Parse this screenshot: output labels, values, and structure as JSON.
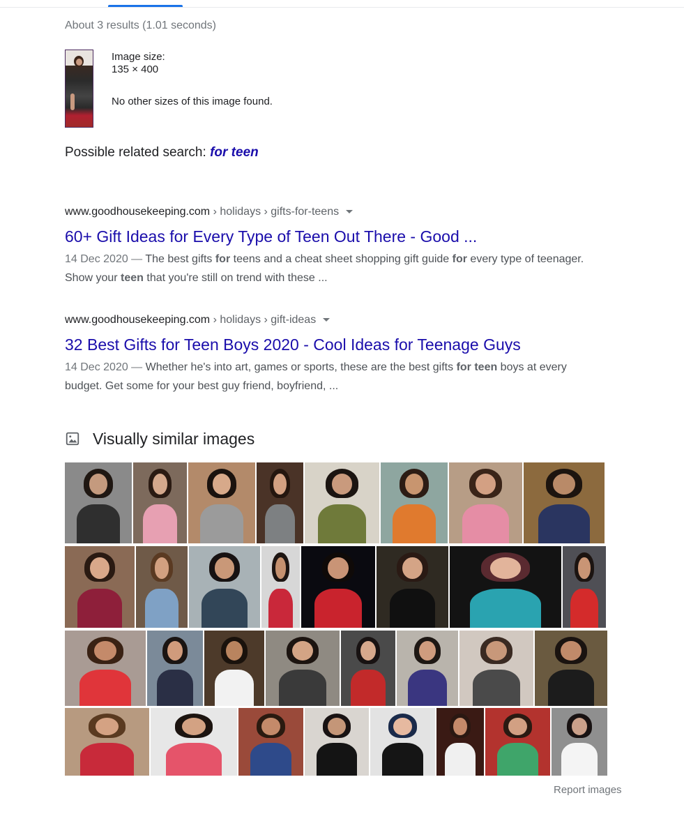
{
  "stats": "About 3 results (1.01 seconds)",
  "image_info": {
    "size_label": "Image size:",
    "size_value": "135 × 400",
    "no_other_sizes": "No other sizes of this image found."
  },
  "related": {
    "prefix": "Possible related search:",
    "query": "for teen"
  },
  "results": [
    {
      "domain": "www.goodhousekeeping.com",
      "path": " › holidays › gifts-for-teens",
      "title": "60+ Gift Ideas for Every Type of Teen Out There - Good ...",
      "date": "14 Dec 2020 — ",
      "snippet_html": "The best gifts <b>for</b> teens and a cheat sheet shopping gift guide <b>for</b> every type of teenager. Show your <b>teen</b> that you're still on trend with these ..."
    },
    {
      "domain": "www.goodhousekeeping.com",
      "path": " › holidays › gift-ideas",
      "title": "32 Best Gifts for Teen Boys 2020 - Cool Ideas for Teenage Guys",
      "date": "14 Dec 2020 — ",
      "snippet_html": "Whether he's into art, games or sports, these are the best gifts <b>for teen</b> boys at every budget. Get some for your best guy friend, boyfriend, ..."
    }
  ],
  "visually_similar": {
    "heading": "Visually similar images",
    "icon": "image-icon",
    "rows": [
      [
        {
          "bg": "#8a8a8a",
          "hair": "#1f1712",
          "skin": "#c49a7e",
          "top": "#2f2f2f"
        },
        {
          "bg": "#7d6a5c",
          "hair": "#2a1a12",
          "skin": "#d4a88c",
          "top": "#e7a0b2"
        },
        {
          "bg": "#b38a6a",
          "hair": "#1a120e",
          "skin": "#d7a98a",
          "top": "#9b9b9b"
        },
        {
          "bg": "#4a3327",
          "hair": "#24160f",
          "skin": "#d2a082",
          "top": "#7d8082"
        },
        {
          "bg": "#d8d3c8",
          "hair": "#1b1411",
          "skin": "#c99a7d",
          "top": "#6f7a3a"
        },
        {
          "bg": "#8ea6a0",
          "hair": "#2c1c14",
          "skin": "#c8956f",
          "top": "#e07a2e"
        },
        {
          "bg": "#b79d86",
          "hair": "#3a2418",
          "skin": "#d3a083",
          "top": "#e58da5"
        },
        {
          "bg": "#8c6a3e",
          "hair": "#1c140f",
          "skin": "#b98a68",
          "top": "#2a3560"
        }
      ],
      [
        {
          "bg": "#8a6a55",
          "hair": "#2a1a12",
          "skin": "#d9a88a",
          "top": "#8e1f3a"
        },
        {
          "bg": "#6f5a48",
          "hair": "#5a3a22",
          "skin": "#d2a080",
          "top": "#7fa1c5"
        },
        {
          "bg": "#a8b2b6",
          "hair": "#171212",
          "skin": "#c99878",
          "top": "#324658"
        },
        {
          "bg": "#d7d7d7",
          "hair": "#1d1512",
          "skin": "#c5916f",
          "top": "#c9283a"
        },
        {
          "bg": "#0a0a10",
          "hair": "#0f0a08",
          "skin": "#c99476",
          "top": "#c9232d"
        },
        {
          "bg": "#2f2a22",
          "hair": "#2a1a14",
          "skin": "#d4a486",
          "top": "#101010"
        },
        {
          "bg": "#131313",
          "hair": "#5a2a30",
          "skin": "#e2b49b",
          "top": "#2aa3b0"
        },
        {
          "bg": "#4f4f55",
          "hair": "#1c1411",
          "skin": "#c99575",
          "top": "#d42b2b"
        }
      ],
      [
        {
          "bg": "#a99b94",
          "hair": "#3a2214",
          "skin": "#c48a6a",
          "top": "#e0353a"
        },
        {
          "bg": "#7b8a99",
          "hair": "#1a1412",
          "skin": "#d09b7c",
          "top": "#2a2f45"
        },
        {
          "bg": "#4d3a2a",
          "hair": "#1a120c",
          "skin": "#b9845f",
          "top": "#f2f2f2"
        },
        {
          "bg": "#8f8a82",
          "hair": "#1c1410",
          "skin": "#d3a485",
          "top": "#3a3a3a"
        },
        {
          "bg": "#4a4a4a",
          "hair": "#181212",
          "skin": "#d6a88c",
          "top": "#c22a2a"
        },
        {
          "bg": "#b9b4ac",
          "hair": "#1e1814",
          "skin": "#cf9c7e",
          "top": "#3a3680"
        },
        {
          "bg": "#d1c8c0",
          "hair": "#3a2a22",
          "skin": "#c8987a",
          "top": "#4a4a4a"
        },
        {
          "bg": "#6a5a40",
          "hair": "#1a1310",
          "skin": "#c08a6a",
          "top": "#1c1c1c"
        }
      ],
      [
        {
          "bg": "#b79a80",
          "hair": "#5a3a20",
          "skin": "#d4a283",
          "top": "#c82a3a"
        },
        {
          "bg": "#e7e7e7",
          "hair": "#1c1410",
          "skin": "#d3a283",
          "top": "#e5546a"
        },
        {
          "bg": "#9a4a3a",
          "hair": "#2a1a10",
          "skin": "#c48a6a",
          "top": "#2e4a8a"
        },
        {
          "bg": "#d9d5d0",
          "hair": "#181212",
          "skin": "#c49678",
          "top": "#141414"
        },
        {
          "bg": "#e3e3e3",
          "hair": "#1a2a4a",
          "skin": "#e6b9a0",
          "top": "#151515"
        },
        {
          "bg": "#3a1a14",
          "hair": "#2a1812",
          "skin": "#c48a6a",
          "top": "#f0f0f0"
        },
        {
          "bg": "#b3332e",
          "hair": "#2a1a12",
          "skin": "#d2a083",
          "top": "#3fa56a"
        },
        {
          "bg": "#8f8f8f",
          "hair": "#181212",
          "skin": "#caa08a",
          "top": "#f4f4f4"
        }
      ]
    ]
  },
  "report_images": "Report images"
}
